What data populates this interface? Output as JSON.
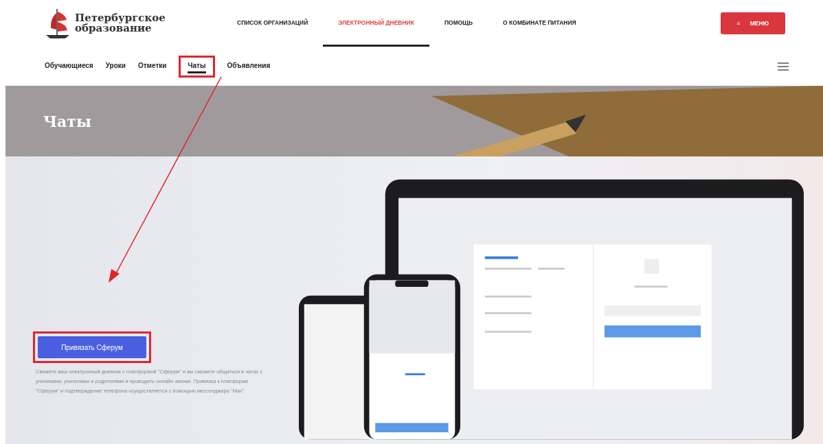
{
  "logo": {
    "line1": "Петербургское",
    "line2": "образование"
  },
  "nav": [
    {
      "label": "СПИСОК ОРГАНИЗАЦИЙ",
      "selected": false
    },
    {
      "label": "ЭЛЕКТРОННЫЙ ДНЕВНИК",
      "selected": true
    },
    {
      "label": "ПОМОЩЬ",
      "selected": false
    },
    {
      "label": "О КОМБИНАТЕ ПИТАНИЯ",
      "selected": false
    }
  ],
  "menu_button": {
    "icon": "≡",
    "label": "МЕНЮ"
  },
  "tabs": [
    {
      "label": "Обучающиеся",
      "selected": false,
      "highlighted": false
    },
    {
      "label": "Уроки",
      "selected": false,
      "highlighted": false
    },
    {
      "label": "Отметки",
      "selected": false,
      "highlighted": false
    },
    {
      "label": "Чаты",
      "selected": true,
      "highlighted": true
    },
    {
      "label": "Объявления",
      "selected": false,
      "highlighted": false
    }
  ],
  "hero": {
    "title": "Чаты"
  },
  "connect_button": {
    "label": "Привязать Сферум",
    "highlighted": true
  },
  "description": "Свяжите ваш электронный дневник с платформой \"Сферум\" и вы сможете общаться в чатах с учениками, учителями и родителями и проводить онлайн звонки. Привязка к платформе \"Сферум\" и подтверждение телефона осуществляется с помощью мессенджера \"Max\""
}
